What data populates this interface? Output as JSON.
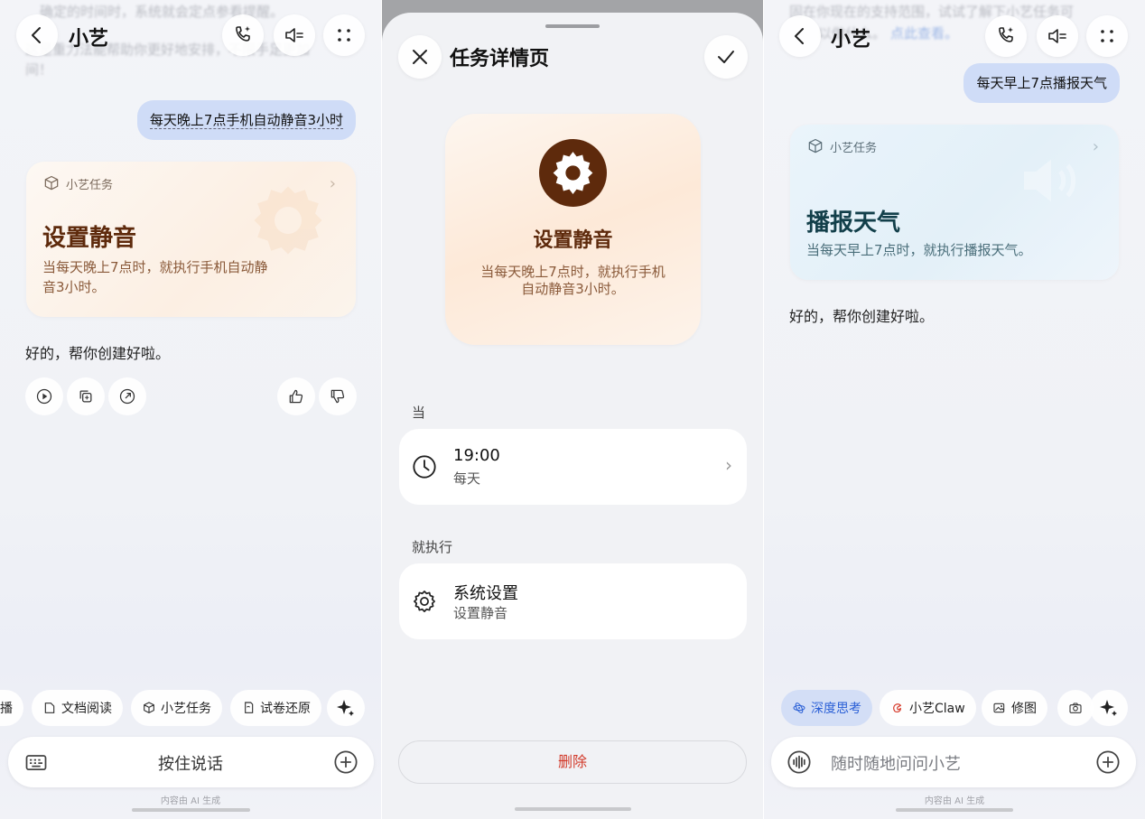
{
  "colors": {
    "accent_blue": "#2a5fd6",
    "task_brown": "#5e2a0c",
    "weather_teal": "#123f4a",
    "delete_red": "#d23a2a"
  },
  "panel1": {
    "title": "小艺",
    "faded_lines": [
      "确定的时间时，系统就会定点参看提醒。",
      "这是重力法能帮助你更好地安排，不限手足更加",
      "间！"
    ],
    "user_message": "每天晚上7点手机自动静音3小时",
    "card": {
      "tag": "小艺任务",
      "title": "设置静音",
      "desc_line1": "当每天晚上7点时，就执行手机自动静",
      "desc_line2": "音3小时。"
    },
    "reply": "好的，帮你创建好啦。",
    "chips": [
      "播",
      "文档阅读",
      "小艺任务",
      "试卷还原"
    ],
    "input_label": "按住说话",
    "footer": "内容由 AI 生成"
  },
  "panel2": {
    "title": "任务详情页",
    "card_title": "设置静音",
    "card_desc_line1": "当每天晚上7点时，就执行手机",
    "card_desc_line2": "自动静音3小时。",
    "when_label": "当",
    "time_value": "19:00",
    "time_repeat": "每天",
    "then_label": "就执行",
    "action_title": "系统设置",
    "action_sub": "设置静音",
    "delete_label": "删除"
  },
  "panel3": {
    "title": "小艺",
    "faded_line1": "固在你现在的支持范围，试试了解下小艺任务可",
    "faded_line2_a": "以做什么。",
    "faded_line2_link": "点此查看。",
    "user_message": "每天早上7点播报天气",
    "card": {
      "tag": "小艺任务",
      "title": "播报天气",
      "desc": "当每天早上7点时，就执行播报天气。"
    },
    "reply": "好的，帮你创建好啦。",
    "chips": [
      "深度思考",
      "小艺Claw",
      "修图"
    ],
    "input_placeholder": "随时随地问问小艺",
    "footer": "内容由 AI 生成"
  }
}
